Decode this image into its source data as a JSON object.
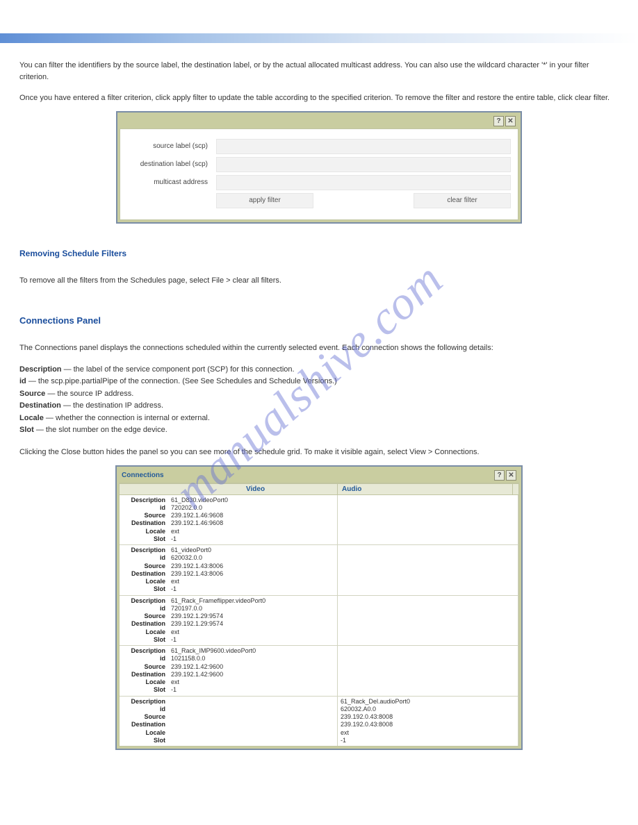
{
  "watermark": "manualshive.com",
  "intro": {
    "p1": "You can filter the identifiers by the source label, the destination label, or by the actual allocated multicast address. You can also use the wildcard character '*' in your filter criterion.",
    "p2": "Once you have entered a filter criterion, click apply filter to update the table according to the specified criterion. To remove the filter and restore the entire table, click clear filter."
  },
  "filter": {
    "titlebar": "",
    "help": "?",
    "close": "✕",
    "labels": {
      "source": "source label (scp)",
      "dest": "destination label (scp)",
      "multicast": "multicast address"
    },
    "apply": "apply filter",
    "clear": "clear filter"
  },
  "section": {
    "title_remove": "Removing Schedule Filters",
    "remove_text": "To remove all the filters from the Schedules page, select File > clear all filters.",
    "title_conn": "Connections Panel",
    "conn_para": "The Connections panel displays the connections scheduled within the currently selected event. Each connection shows the following details:",
    "detail1_label": "Description",
    "detail1_text": " — the label of the service component port (SCP) for this connection.",
    "detail2_label": "id",
    "detail2_text": " — the scp.pipe.partialPipe of the connection. (See See Schedules and Schedule Versions.)",
    "detail3_label": "Source",
    "detail3_text": " — the source IP address.",
    "detail4_label": "Destination",
    "detail4_text": " — the destination IP address.",
    "detail5_label": "Locale",
    "detail5_text": " — whether the connection is internal or external.",
    "detail6_label": "Slot",
    "detail6_text": " — the slot number on the edge device.",
    "close_para": "Clicking the Close button hides the panel so you can see more of the schedule grid. To make it visible again, select View > Connections."
  },
  "connections": {
    "title": "Connections",
    "help": "?",
    "close": "✕",
    "col_video": "Video",
    "col_audio": "Audio",
    "row_labels": [
      "Description",
      "id",
      "Source",
      "Destination",
      "Locale",
      "Slot"
    ],
    "rows": [
      {
        "video": [
          "61_D830.videoPort0",
          "720202.0.0",
          "239.192.1.46:9608",
          "239.192.1.46:9608",
          "ext",
          "-1"
        ],
        "audio": [
          "",
          "",
          "",
          "",
          "",
          ""
        ]
      },
      {
        "video": [
          "61_videoPort0",
          "620032.0.0",
          "239.192.1.43:8006",
          "239.192.1.43:8006",
          "ext",
          "-1"
        ],
        "audio": [
          "",
          "",
          "",
          "",
          "",
          ""
        ]
      },
      {
        "video": [
          "61_Rack_Frameflipper.videoPort0",
          "720197.0.0",
          "239.192.1.29:9574",
          "239.192.1.29:9574",
          "ext",
          "-1"
        ],
        "audio": [
          "",
          "",
          "",
          "",
          "",
          ""
        ]
      },
      {
        "video": [
          "61_Rack_IMP9600.videoPort0",
          "1021158.0.0",
          "239.192.1.42:9600",
          "239.192.1.42:9600",
          "ext",
          "-1"
        ],
        "audio": [
          "",
          "",
          "",
          "",
          "",
          ""
        ]
      },
      {
        "video": [
          "",
          "",
          "",
          "",
          "",
          ""
        ],
        "audio": [
          "61_Rack_Del.audioPort0",
          "620032.A0.0",
          "239.192.0.43:8008",
          "239.192.0.43:8008",
          "ext",
          "-1"
        ]
      }
    ]
  }
}
